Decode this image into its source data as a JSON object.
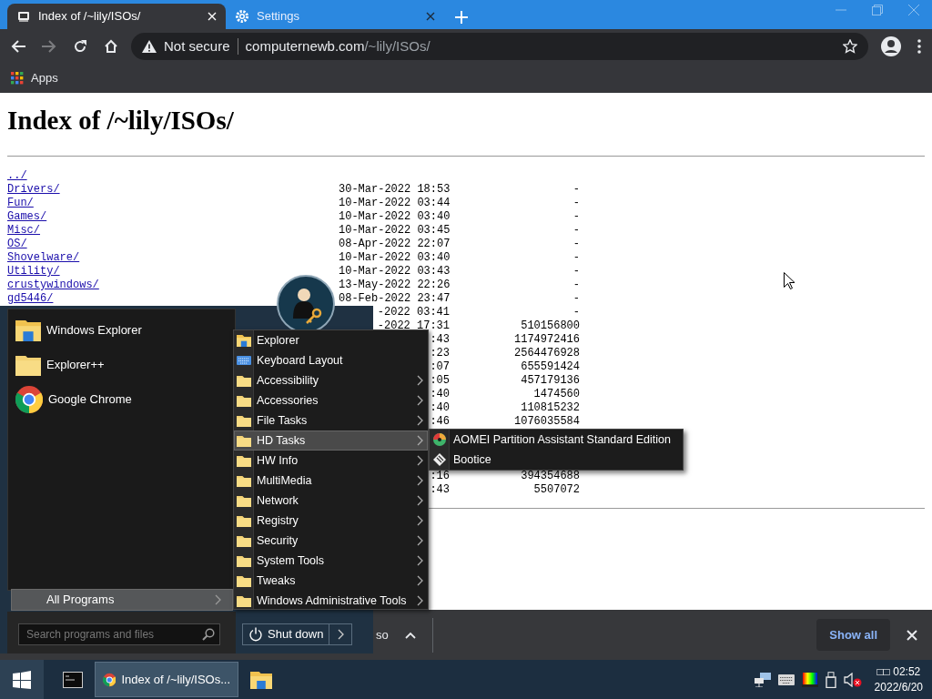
{
  "browser": {
    "tabs": [
      {
        "title": "Index of /~lily/ISOs/",
        "kind": "page",
        "selected": true
      },
      {
        "title": "Settings",
        "kind": "settings",
        "selected": false
      }
    ],
    "toolbar": {
      "forward_disabled": true,
      "security": "Not secure",
      "url_domain": "computernewb.com",
      "url_path": "/~lily/ISOs/"
    },
    "bookmarks": [
      {
        "label": "Apps"
      }
    ]
  },
  "page": {
    "heading": "Index of /~lily/ISOs/",
    "listing": [
      {
        "name": "../"
      },
      {
        "name": "Drivers/",
        "date": "30-Mar-2022 18:53",
        "size": "-"
      },
      {
        "name": "Fun/",
        "date": "10-Mar-2022 03:44",
        "size": "-"
      },
      {
        "name": "Games/",
        "date": "10-Mar-2022 03:40",
        "size": "-"
      },
      {
        "name": "Misc/",
        "date": "10-Mar-2022 03:45",
        "size": "-"
      },
      {
        "name": "OS/",
        "date": "08-Apr-2022 22:07",
        "size": "-"
      },
      {
        "name": "Shovelware/",
        "date": "10-Mar-2022 03:40",
        "size": "-"
      },
      {
        "name": "Utility/",
        "date": "10-Mar-2022 03:43",
        "size": "-"
      },
      {
        "name": "crustywindows/",
        "date": "13-May-2022 22:26",
        "size": "-"
      },
      {
        "name": "gd5446/",
        "date": "08-Feb-2022 23:47",
        "size": "-"
      },
      {
        "date": "-2022 03:41",
        "size": "-"
      },
      {
        "date": "-2022 17:31",
        "size": "510156800"
      },
      {
        "date": ":43",
        "size": "1174972416"
      },
      {
        "date": ":23",
        "size": "2564476928"
      },
      {
        "date": ":07",
        "size": "655591424"
      },
      {
        "date": ":05",
        "size": "457179136"
      },
      {
        "date": ":40",
        "size": "1474560"
      },
      {
        "date": ":40",
        "size": "110815232"
      },
      {
        "date": ":46",
        "size": "1076035584"
      }
    ],
    "listing_below_menu": [
      {
        "date": ":16",
        "size": "394354688"
      },
      {
        "date": ":43",
        "size": "5507072"
      }
    ]
  },
  "start_menu": {
    "pinned": [
      {
        "label": "Windows Explorer",
        "kind": "explorer"
      },
      {
        "label": "Explorer++",
        "kind": "folder"
      },
      {
        "label": "Google Chrome",
        "kind": "chrome"
      }
    ],
    "all_programs": "All Programs",
    "search_placeholder": "Search programs and files",
    "shutdown": "Shut down",
    "programs": [
      {
        "label": "Explorer",
        "kind": "explorer",
        "submenu": false,
        "selected": false
      },
      {
        "label": "Keyboard Layout",
        "kind": "keyboard",
        "submenu": false,
        "selected": false
      },
      {
        "label": "Accessibility",
        "kind": "folder",
        "submenu": true,
        "selected": false
      },
      {
        "label": "Accessories",
        "kind": "folder",
        "submenu": true,
        "selected": false
      },
      {
        "label": "File Tasks",
        "kind": "folder",
        "submenu": true,
        "selected": false
      },
      {
        "label": "HD Tasks",
        "kind": "folder",
        "submenu": true,
        "selected": true
      },
      {
        "label": "HW Info",
        "kind": "folder",
        "submenu": true,
        "selected": false
      },
      {
        "label": "MultiMedia",
        "kind": "folder",
        "submenu": true,
        "selected": false
      },
      {
        "label": "Network",
        "kind": "folder",
        "submenu": true,
        "selected": false
      },
      {
        "label": "Registry",
        "kind": "folder",
        "submenu": true,
        "selected": false
      },
      {
        "label": "Security",
        "kind": "folder",
        "submenu": true,
        "selected": false
      },
      {
        "label": "System Tools",
        "kind": "folder",
        "submenu": true,
        "selected": false
      },
      {
        "label": "Tweaks",
        "kind": "folder",
        "submenu": true,
        "selected": false
      },
      {
        "label": "Windows Administrative Tools",
        "kind": "folder",
        "submenu": true,
        "selected": false
      }
    ],
    "hd_tasks": [
      {
        "label": "AOMEI Partition Assistant Standard Edition",
        "kind": "disk"
      },
      {
        "label": "Bootice",
        "kind": "diamond"
      }
    ]
  },
  "downloads": {
    "item_fragment": "so",
    "show_all": "Show all"
  },
  "taskbar": {
    "start_selected": true,
    "apps": [
      {
        "kind": "cmd",
        "active": false
      },
      {
        "kind": "chrome",
        "label": "Index of /~lily/ISOs...",
        "active": true
      },
      {
        "kind": "folder",
        "active": false
      }
    ],
    "time": "□□ 02:52",
    "date": "2022/6/20"
  }
}
